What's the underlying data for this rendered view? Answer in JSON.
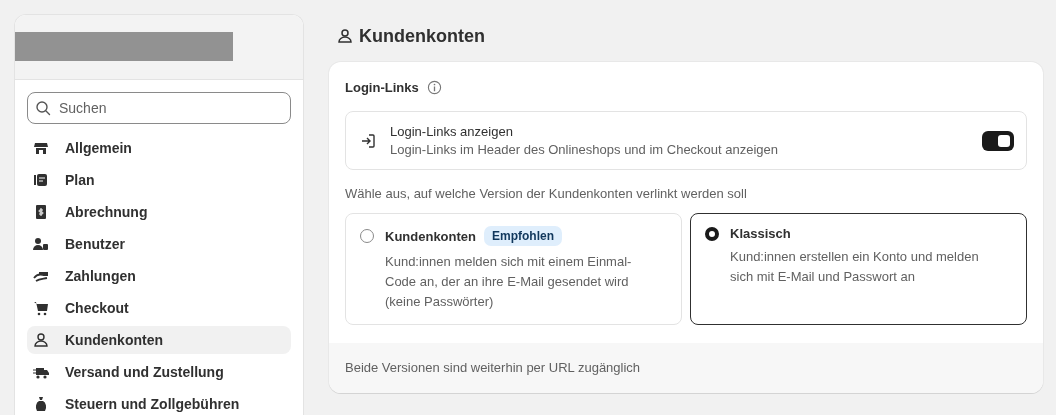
{
  "sidebar": {
    "search": {
      "placeholder": "Suchen"
    },
    "items": [
      {
        "label": "Allgemein",
        "selected": false
      },
      {
        "label": "Plan",
        "selected": false
      },
      {
        "label": "Abrechnung",
        "selected": false
      },
      {
        "label": "Benutzer",
        "selected": false
      },
      {
        "label": "Zahlungen",
        "selected": false
      },
      {
        "label": "Checkout",
        "selected": false
      },
      {
        "label": "Kundenkonten",
        "selected": true
      },
      {
        "label": "Versand und Zustellung",
        "selected": false
      },
      {
        "label": "Steuern und Zollgebühren",
        "selected": false
      }
    ]
  },
  "page": {
    "title": "Kundenkonten"
  },
  "card": {
    "title": "Login-Links",
    "toggle_row": {
      "title": "Login-Links anzeigen",
      "description": "Login-Links im Header des Onlineshops und im Checkout anzeigen",
      "on": true
    },
    "prompt": "Wähle aus, auf welche Version der Kundenkonten verlinkt werden soll",
    "options": [
      {
        "title": "Kundenkonten",
        "badge": "Empfohlen",
        "description": "Kund:innen melden sich mit einem Einmal-Code an, der an ihre E-Mail gesendet wird (keine Passwörter)",
        "selected": false
      },
      {
        "title": "Klassisch",
        "description": "Kund:innen erstellen ein Konto und melden sich mit E-Mail und Passwort an",
        "selected": true
      }
    ],
    "footer": "Beide Versionen sind weiterhin per URL zugänglich"
  }
}
